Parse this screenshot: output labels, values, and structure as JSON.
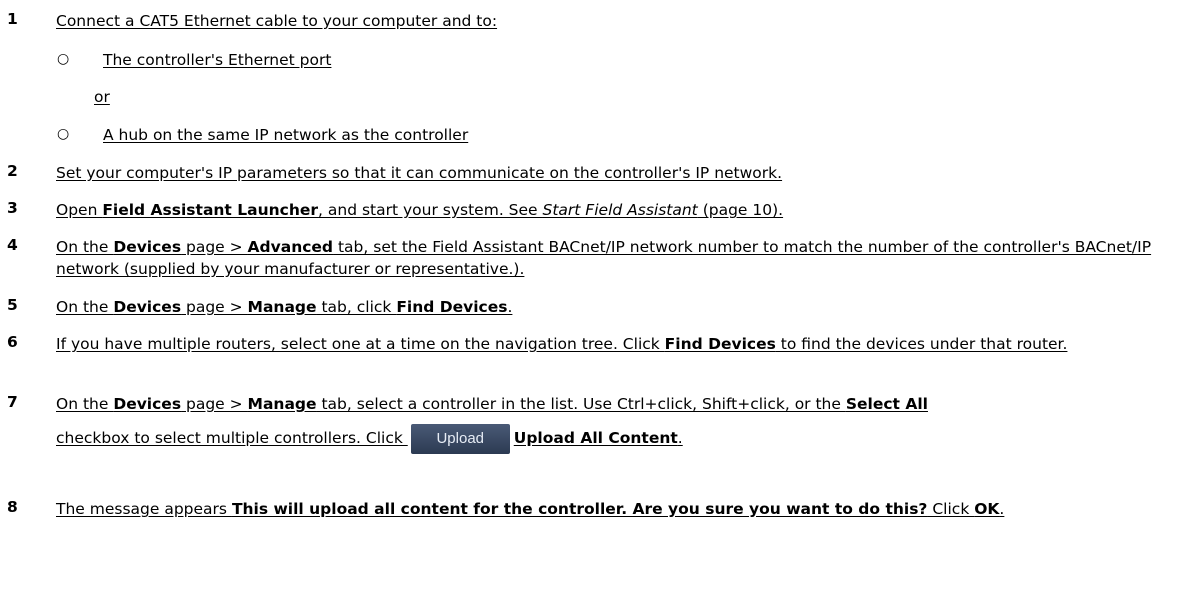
{
  "steps": [
    {
      "n": "1",
      "text": "Connect a CAT5 Ethernet cable to your computer and to:"
    },
    {
      "n": "2",
      "text": "Set your computer's IP parameters so that it can communicate on the controller's IP network."
    },
    {
      "n": "3",
      "a": "Open ",
      "b": "Field Assistant Launcher",
      "c": ", and start your system. See ",
      "i": "Start Field Assistant",
      "d": " (page 10)."
    },
    {
      "n": "4",
      "a": "On the ",
      "b1": "Devices",
      "c": " page > ",
      "b2": "Advanced",
      "d": " tab, set the Field Assistant BACnet/IP network number to match the number of the controller's BACnet/IP network (supplied by your manufacturer or representative.)."
    },
    {
      "n": "5",
      "a": "On the ",
      "b1": "Devices",
      "c": " page > ",
      "b2": "Manage",
      "d": " tab, click ",
      "b3": "Find Devices",
      "e": "."
    },
    {
      "n": "6",
      "a": "If you have multiple routers, select one at a time on the navigation tree. Click ",
      "b": "Find Devices",
      "c": " to find the devices under that router."
    },
    {
      "n": "7",
      "a": "On the ",
      "b1": "Devices",
      "c": " page > ",
      "b2": "Manage",
      "d": " tab, select a controller in the list. Use Ctrl+click, Shift+click, or the ",
      "b3": "Select All",
      "e": "checkbox to select multiple controllers. Click ",
      "button": "Upload",
      "b4": "Upload All Content",
      "f": "."
    },
    {
      "n": "8",
      "a": "The message appears ",
      "b": "This will upload all content for the controller. Are you sure you want to do this?",
      "c": " Click ",
      "b2": "OK",
      "d": "."
    }
  ],
  "sub": {
    "bullet": "○",
    "item1": "The controller's Ethernet port",
    "or": "or",
    "item2": "A hub on the same IP network as the controller"
  }
}
